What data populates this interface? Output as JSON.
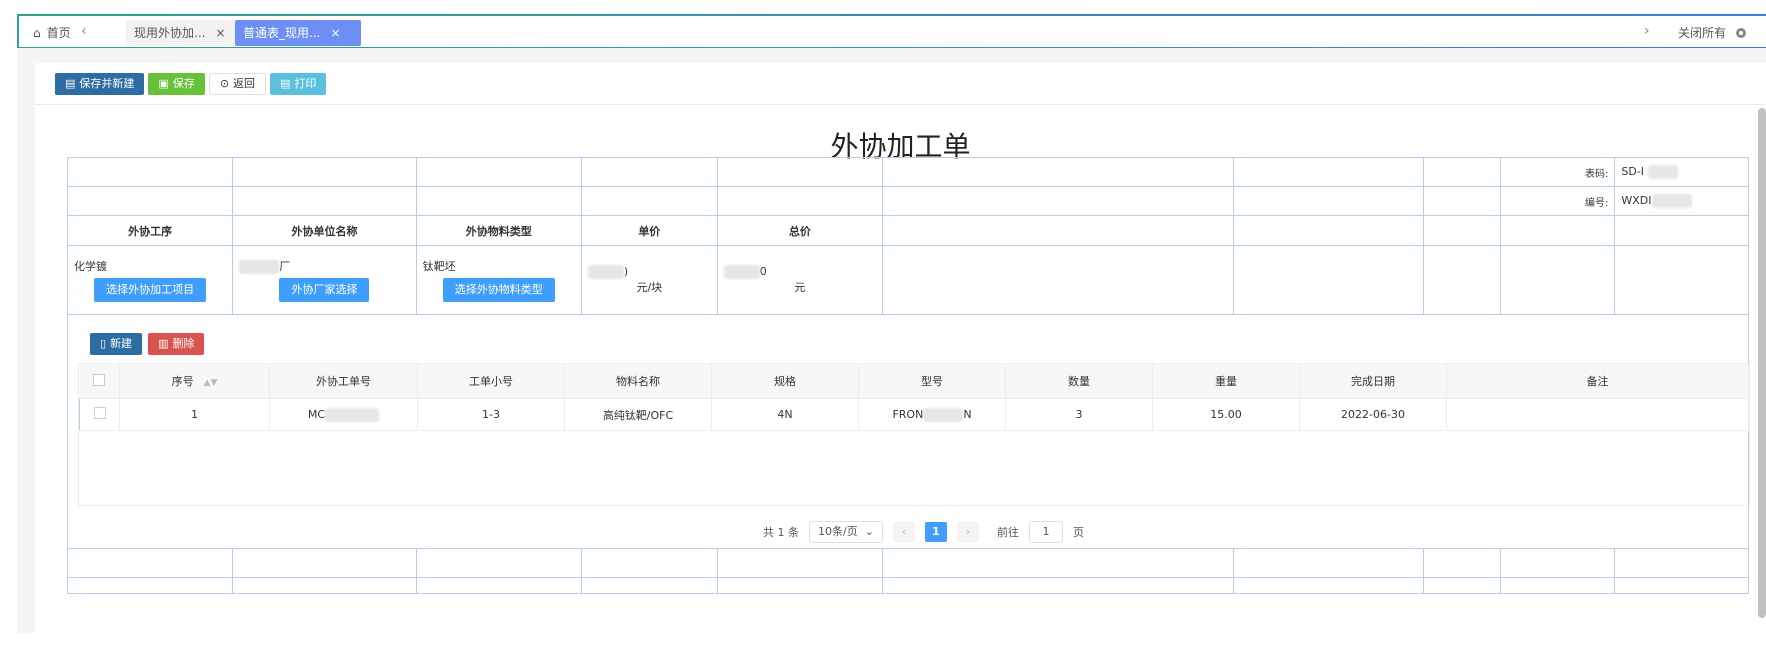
{
  "tabs": {
    "home": "首页",
    "tab1": "现用外协加...",
    "tab2": "普通表_现用...",
    "close_all": "关闭所有"
  },
  "toolbar": {
    "save_new": "保存并新建",
    "save": "保存",
    "back": "返回",
    "print": "打印"
  },
  "form": {
    "title": "外协加工单",
    "code_label": "表码:",
    "code_value": "SD-I",
    "number_label": "编号:",
    "number_value": "WXDI",
    "headers": [
      "外协工序",
      "外协单位名称",
      "外协物料类型",
      "单价",
      "总价"
    ],
    "process_value": "化学镀",
    "process_button": "选择外协加工项目",
    "vendor_value": "厂",
    "vendor_button": "外协厂家选择",
    "material_value": "钛靶坯",
    "material_button": "选择外协物料类型",
    "unit_price_value": ")",
    "unit_price_unit": "元/块",
    "total_price_value": "0",
    "total_price_unit": "元"
  },
  "sub": {
    "new_button": "新建",
    "delete_button": "删除",
    "columns": [
      "序号",
      "外协工单号",
      "工单小号",
      "物料名称",
      "规格",
      "型号",
      "数量",
      "重量",
      "完成日期",
      "备注"
    ],
    "rows": [
      {
        "seq": "1",
        "order_no": "MC",
        "sub_no": "1-3",
        "material": "高纯钛靶/OFC",
        "spec": "4N",
        "model_a": "FRON",
        "model_b": "N",
        "qty": "3",
        "weight": "15.00",
        "date": "2022-06-30",
        "note": ""
      }
    ]
  },
  "pager": {
    "total": "共 1 条",
    "page_size": "10条/页",
    "current": "1",
    "goto_label": "前往",
    "goto_value": "1",
    "page_suffix": "页"
  }
}
